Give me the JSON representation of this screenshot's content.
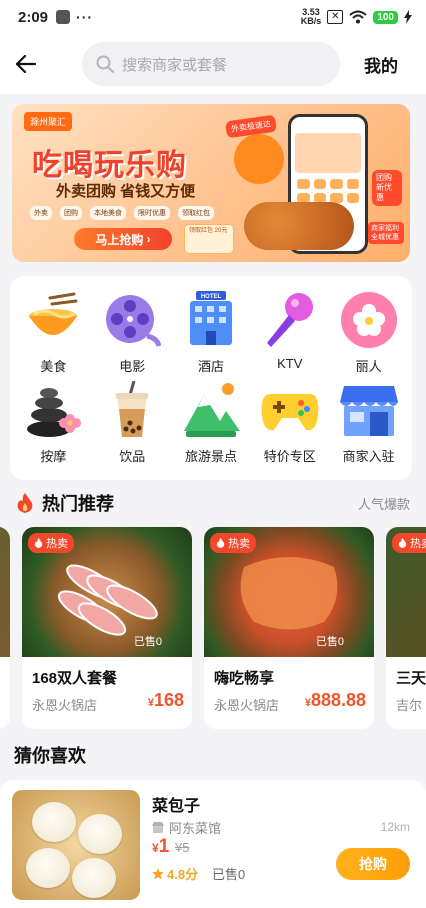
{
  "status_bar": {
    "time": "2:09",
    "dots": "···",
    "speed_top": "3.53",
    "speed_bottom": "KB/s",
    "battery": "100"
  },
  "header": {
    "search_placeholder": "搜索商家或套餐",
    "mine_label": "我的"
  },
  "banner": {
    "brand": "滁州聚汇",
    "headline": "吃喝玩乐购",
    "subtitle": "外卖团购 省钱又方便",
    "categories": [
      "外卖",
      "团购",
      "本地美食",
      "限时优惠",
      "领取红包"
    ],
    "button": "马上抢购",
    "coupon": "领取红包 20元",
    "tag_delivery": "外卖极速达",
    "tag_group": "团购新优惠",
    "tag_merchant": "商家福利全城优惠"
  },
  "categories": [
    {
      "label": "美食",
      "icon": "noodle-bowl-icon"
    },
    {
      "label": "电影",
      "icon": "film-reel-icon"
    },
    {
      "label": "酒店",
      "icon": "hotel-icon"
    },
    {
      "label": "KTV",
      "icon": "microphone-icon"
    },
    {
      "label": "丽人",
      "icon": "flower-icon"
    },
    {
      "label": "按摩",
      "icon": "spa-stones-icon"
    },
    {
      "label": "饮品",
      "icon": "bubble-tea-icon"
    },
    {
      "label": "旅游景点",
      "icon": "mountain-icon"
    },
    {
      "label": "特价专区",
      "icon": "gamepad-icon"
    },
    {
      "label": "商家入驻",
      "icon": "storefront-icon"
    }
  ],
  "hot": {
    "title": "热门推荐",
    "more": "人气爆款",
    "items": [
      {
        "badge": "热卖",
        "sold": "已售0",
        "name": "168双人套餐",
        "shop": "永恩火锅店",
        "currency": "¥",
        "price": "168"
      },
      {
        "badge": "热卖",
        "sold": "已售0",
        "name": "嗨吃畅享",
        "shop": "永恩火锅店",
        "currency": "¥",
        "price": "888.88"
      },
      {
        "badge": "热卖",
        "name": "三天",
        "shop": "吉尔"
      }
    ]
  },
  "guess": {
    "title": "猜你喜欢",
    "item": {
      "name": "菜包子",
      "shop": "阿东菜馆",
      "distance": "12km",
      "currency": "¥",
      "price": "1",
      "original_price": "¥5",
      "rating": "4.8分",
      "sold": "已售0",
      "button": "抢购"
    }
  },
  "colors": {
    "accent": "#f2542b",
    "button_orange": "#ffa612",
    "background": "#f4f4f6"
  }
}
